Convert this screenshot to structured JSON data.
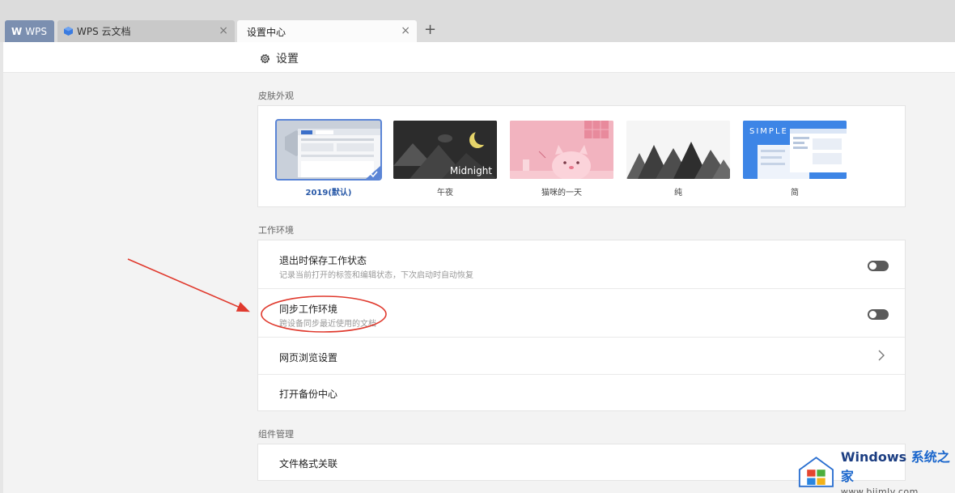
{
  "tabs": [
    {
      "label": "WPS",
      "logo": "W"
    },
    {
      "label": "WPS 云文档",
      "close": "×"
    },
    {
      "label": "设置中心",
      "close": "×"
    }
  ],
  "new_tab_symbol": "+",
  "header": {
    "title": "设置"
  },
  "skins": {
    "section_label": "皮肤外观",
    "items": [
      {
        "name": "2019(默认)",
        "selected": true
      },
      {
        "name": "午夜",
        "overlay": "Midnight"
      },
      {
        "name": "猫咪的一天"
      },
      {
        "name": "纯"
      },
      {
        "name": "简",
        "overlay": "SIMPLE"
      }
    ]
  },
  "workspace": {
    "section_label": "工作环境",
    "items": [
      {
        "title": "退出时保存工作状态",
        "desc": "记录当前打开的标签和编辑状态，下次启动时自动恢复",
        "control": "toggle"
      },
      {
        "title": "同步工作环境",
        "desc": "跨设备同步最近使用的文档",
        "control": "toggle"
      },
      {
        "title": "网页浏览设置",
        "control": "chevron"
      },
      {
        "title": "打开备份中心"
      }
    ]
  },
  "components": {
    "section_label": "组件管理",
    "items": [
      {
        "title": "文件格式关联"
      }
    ]
  },
  "watermark": {
    "brand": "Windows",
    "brand_cn": "系统之家",
    "url": "www.bjjmlv.com"
  },
  "colors": {
    "accent": "#5b85d6",
    "annotation_red": "#e03a2e"
  }
}
